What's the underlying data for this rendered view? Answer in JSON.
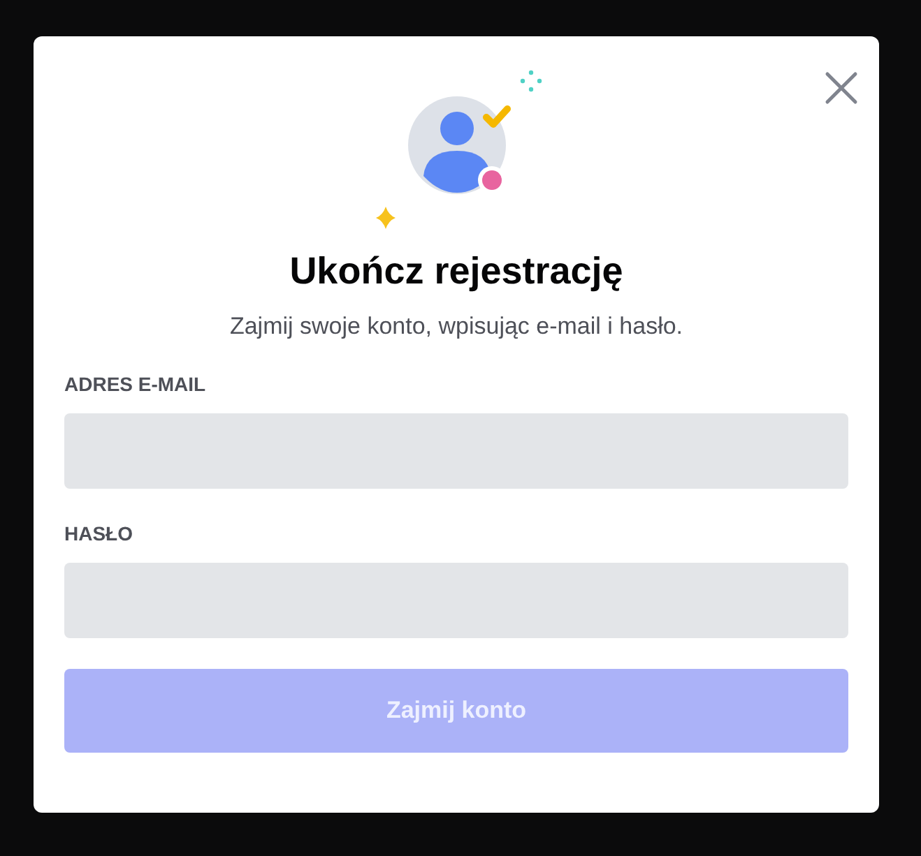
{
  "modal": {
    "title": "Ukończ rejestrację",
    "subtitle": "Zajmij swoje konto, wpisując e-mail i hasło.",
    "fields": [
      {
        "label": "ADRES E-MAIL"
      },
      {
        "label": "HASŁO"
      }
    ],
    "submit": {
      "label": "Zajmij konto",
      "disabled": true
    }
  }
}
